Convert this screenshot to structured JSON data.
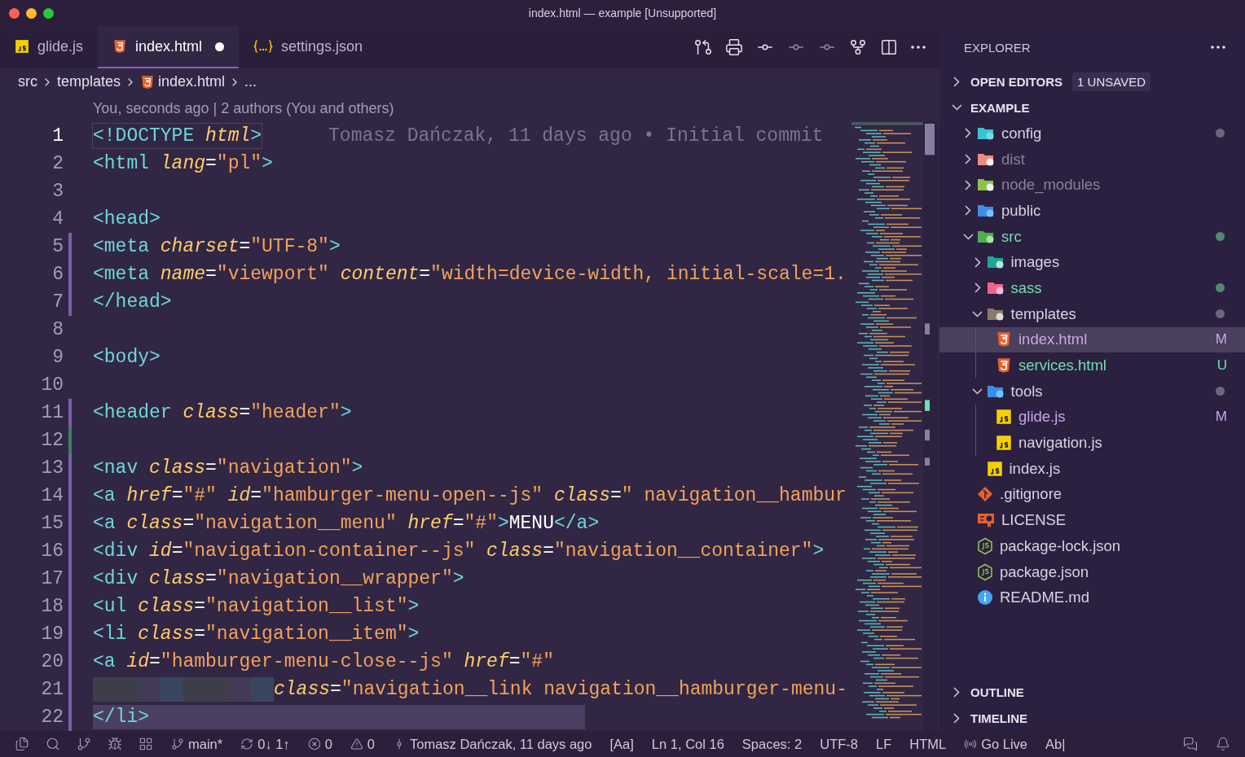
{
  "window": {
    "title": "index.html — example [Unsupported]"
  },
  "tabs": [
    {
      "label": "glide.js",
      "kind": "js",
      "selected": false,
      "dirty": false
    },
    {
      "label": "index.html",
      "kind": "html",
      "selected": true,
      "dirty": true
    },
    {
      "label": "settings.json",
      "kind": "json",
      "selected": false,
      "dirty": false
    }
  ],
  "breadcrumb": [
    {
      "label": "src"
    },
    {
      "label": "templates"
    },
    {
      "label": "index.html",
      "kind": "html"
    },
    {
      "label": "..."
    }
  ],
  "codelens": "You, seconds ago | 2 authors (You and others)",
  "lines": [
    {
      "number": "1",
      "current": true,
      "blame": "Tomasz Dańczak, 11 days ago • Initial commit",
      "tokens": [
        {
          "kind": "tag",
          "text": "<!DOCTYPE"
        },
        {
          "kind": "attr",
          "text": " html"
        },
        {
          "kind": "tag",
          "text": ">"
        }
      ]
    },
    {
      "number": "2",
      "current": false,
      "tokens": [
        {
          "kind": "tag",
          "text": "<html"
        },
        {
          "kind": "attr",
          "text": " lang"
        },
        {
          "kind": "plain",
          "text": "="
        },
        {
          "kind": "str",
          "text": "\"pl\""
        },
        {
          "kind": "tag",
          "text": ">"
        }
      ]
    },
    {
      "number": "3",
      "current": false
    },
    {
      "number": "4",
      "current": false,
      "tokens": [
        {
          "kind": "tag",
          "text": "<head>"
        }
      ]
    },
    {
      "number": "5",
      "current": false,
      "modified": true,
      "tokens": [
        {
          "kind": "tag",
          "text": "<meta"
        },
        {
          "kind": "attr",
          "text": " charset"
        },
        {
          "kind": "plain",
          "text": "="
        },
        {
          "kind": "str",
          "text": "\"UTF-8\""
        },
        {
          "kind": "tag",
          "text": ">"
        }
      ]
    },
    {
      "number": "6",
      "current": false,
      "modified": true,
      "tokens": [
        {
          "kind": "tag",
          "text": "<meta"
        },
        {
          "kind": "attr",
          "text": " name"
        },
        {
          "kind": "plain",
          "text": "="
        },
        {
          "kind": "str",
          "text": "\"viewport\""
        },
        {
          "kind": "attr",
          "text": " content"
        },
        {
          "kind": "plain",
          "text": "="
        },
        {
          "kind": "str",
          "text": "\"width=device-width, initial-scale=1."
        }
      ]
    },
    {
      "number": "7",
      "current": false,
      "modified": true,
      "tokens": [
        {
          "kind": "tag",
          "text": "</head>"
        }
      ]
    },
    {
      "number": "8",
      "current": false
    },
    {
      "number": "9",
      "current": false,
      "tokens": [
        {
          "kind": "tag",
          "text": "<body>"
        }
      ]
    },
    {
      "number": "10",
      "current": false
    },
    {
      "number": "11",
      "current": false,
      "modified": true,
      "tokens": [
        {
          "kind": "tag",
          "text": "<header"
        },
        {
          "kind": "attr",
          "text": " class"
        },
        {
          "kind": "plain",
          "text": "="
        },
        {
          "kind": "str",
          "text": "\"header\""
        },
        {
          "kind": "tag",
          "text": ">"
        }
      ]
    },
    {
      "number": "12",
      "current": false,
      "added": true
    },
    {
      "number": "13",
      "current": false,
      "modified": true,
      "tokens": [
        {
          "kind": "tag",
          "text": "<nav"
        },
        {
          "kind": "attr",
          "text": " class"
        },
        {
          "kind": "plain",
          "text": "="
        },
        {
          "kind": "str",
          "text": "\"navigation\""
        },
        {
          "kind": "tag",
          "text": ">"
        }
      ]
    },
    {
      "number": "14",
      "current": false,
      "modified": true,
      "tokens": [
        {
          "kind": "tag",
          "text": "<a"
        },
        {
          "kind": "attr",
          "text": " href"
        },
        {
          "kind": "plain",
          "text": "="
        },
        {
          "kind": "str",
          "text": "\"#\""
        },
        {
          "kind": "attr",
          "text": " id"
        },
        {
          "kind": "plain",
          "text": "="
        },
        {
          "kind": "str",
          "text": "\"hamburger-menu-open--js\""
        },
        {
          "kind": "attr",
          "text": " class"
        },
        {
          "kind": "plain",
          "text": "="
        },
        {
          "kind": "str",
          "text": "\" navigation__hambur"
        }
      ]
    },
    {
      "number": "15",
      "current": false,
      "modified": true,
      "tokens": [
        {
          "kind": "tag",
          "text": "<a"
        },
        {
          "kind": "attr",
          "text": " class"
        },
        {
          "kind": "plain",
          "text": "="
        },
        {
          "kind": "str",
          "text": "\"navigation__menu\""
        },
        {
          "kind": "attr",
          "text": " href"
        },
        {
          "kind": "plain",
          "text": "="
        },
        {
          "kind": "str",
          "text": "\"#\""
        },
        {
          "kind": "tag",
          "text": ">"
        },
        {
          "kind": "plain",
          "text": "MENU"
        },
        {
          "kind": "tag",
          "text": "</a>"
        }
      ]
    },
    {
      "number": "16",
      "current": false,
      "modified": true,
      "tokens": [
        {
          "kind": "tag",
          "text": "<div"
        },
        {
          "kind": "attr",
          "text": " id"
        },
        {
          "kind": "plain",
          "text": "="
        },
        {
          "kind": "str",
          "text": "\"navigation-container--js\""
        },
        {
          "kind": "attr",
          "text": " class"
        },
        {
          "kind": "plain",
          "text": "="
        },
        {
          "kind": "str",
          "text": "\"navigation__container\""
        },
        {
          "kind": "tag",
          "text": ">"
        }
      ]
    },
    {
      "number": "17",
      "current": false,
      "modified": true,
      "tokens": [
        {
          "kind": "tag",
          "text": "<div"
        },
        {
          "kind": "attr",
          "text": " class"
        },
        {
          "kind": "plain",
          "text": "="
        },
        {
          "kind": "str",
          "text": "\"navigation__wrapper\""
        },
        {
          "kind": "tag",
          "text": ">"
        }
      ]
    },
    {
      "number": "18",
      "current": false,
      "modified": true,
      "tokens": [
        {
          "kind": "tag",
          "text": "<ul"
        },
        {
          "kind": "attr",
          "text": " class"
        },
        {
          "kind": "plain",
          "text": "="
        },
        {
          "kind": "str",
          "text": "\"navigation__list\""
        },
        {
          "kind": "tag",
          "text": ">"
        }
      ]
    },
    {
      "number": "19",
      "current": false,
      "modified": true,
      "tokens": [
        {
          "kind": "tag",
          "text": "<li"
        },
        {
          "kind": "attr",
          "text": " class"
        },
        {
          "kind": "plain",
          "text": "="
        },
        {
          "kind": "str",
          "text": "\"navigation__item\""
        },
        {
          "kind": "tag",
          "text": ">"
        }
      ]
    },
    {
      "number": "20",
      "current": false,
      "modified": true,
      "tokens": [
        {
          "kind": "tag",
          "text": "<a"
        },
        {
          "kind": "attr",
          "text": " id"
        },
        {
          "kind": "plain",
          "text": "="
        },
        {
          "kind": "str",
          "text": "\"hamburger-menu-close--js\""
        },
        {
          "kind": "attr",
          "text": " href"
        },
        {
          "kind": "plain",
          "text": "="
        },
        {
          "kind": "str",
          "text": "\"#\""
        }
      ]
    },
    {
      "number": "21",
      "current": false,
      "modified": true,
      "kind": "continuation",
      "tokens": [
        {
          "kind": "attr",
          "text": "class"
        },
        {
          "kind": "plain",
          "text": "="
        },
        {
          "kind": "str",
          "text": "\"navigation__link navigation__hamburger-menu-"
        }
      ]
    },
    {
      "number": "22",
      "current": false,
      "modified": true,
      "highlighted": true,
      "tokens": [
        {
          "kind": "tag",
          "text": "</li>"
        }
      ]
    }
  ],
  "explorer": {
    "title": "EXPLORER",
    "sections": [
      {
        "label": "OPEN EDITORS",
        "expanded": false,
        "badge": "1 UNSAVED"
      },
      {
        "label": "EXAMPLE",
        "expanded": true
      }
    ],
    "tree": [
      {
        "label": "config",
        "kind": "config-folder",
        "expanded": false,
        "selected": false,
        "color": "#6e6680"
      },
      {
        "label": "dist",
        "kind": "dist-folder",
        "ignored": true,
        "expanded": false,
        "selected": false
      },
      {
        "label": "node_modules",
        "kind": "node-folder",
        "ignored": true,
        "expanded": false,
        "selected": false
      },
      {
        "label": "public",
        "kind": "public-folder",
        "expanded": false,
        "selected": false
      },
      {
        "label": "src",
        "kind": "src-folder",
        "added": true,
        "expanded": true,
        "selected": false,
        "color": "#4e8a72",
        "children": [
          {
            "label": "images",
            "kind": "images-folder",
            "expanded": false,
            "selected": false
          },
          {
            "label": "sass",
            "kind": "sass-folder",
            "added": true,
            "expanded": false,
            "selected": false,
            "color": "#4e8a72"
          },
          {
            "label": "templates",
            "kind": "templates-folder",
            "expanded": true,
            "selected": false,
            "color": "#6e6680",
            "children": [
              {
                "label": "index.html",
                "kind": "html",
                "modified": true,
                "selected": true,
                "badge": "M"
              },
              {
                "label": "services.html",
                "kind": "html",
                "added": true,
                "selected": false,
                "badge": "U"
              }
            ]
          },
          {
            "label": "tools",
            "kind": "tools-folder",
            "expanded": true,
            "selected": false,
            "color": "#6e6680",
            "children": [
              {
                "label": "glide.js",
                "kind": "js",
                "modified": true,
                "selected": false,
                "badge": "M"
              },
              {
                "label": "navigation.js",
                "kind": "js",
                "selected": false
              }
            ]
          },
          {
            "label": "index.js",
            "kind": "js",
            "selected": false
          }
        ]
      },
      {
        "label": ".gitignore",
        "kind": "git",
        "selected": false
      },
      {
        "label": "LICENSE",
        "kind": "license",
        "selected": false
      },
      {
        "label": "package-lock.json",
        "kind": "node",
        "selected": false
      },
      {
        "label": "package.json",
        "kind": "node",
        "selected": false
      },
      {
        "label": "README.md",
        "kind": "info",
        "selected": false
      }
    ],
    "bottom_sections": [
      {
        "label": "OUTLINE",
        "expanded": false
      },
      {
        "label": "TIMELINE",
        "expanded": false
      }
    ]
  },
  "status_bar": [
    {
      "kind": "branch",
      "text": "main*"
    },
    {
      "kind": "sync",
      "text": "0↓ 1↑"
    },
    {
      "kind": "error",
      "text": "0"
    },
    {
      "kind": "warning",
      "text": "0"
    },
    {
      "kind": "commit",
      "text": "Tomasz Dańczak, 11 days ago"
    },
    {
      "text": "[Aa]"
    },
    {
      "text": "Ln 1, Col 16"
    },
    {
      "text": "Spaces: 2"
    },
    {
      "text": "UTF-8"
    },
    {
      "text": "LF"
    },
    {
      "text": "HTML"
    },
    {
      "kind": "live",
      "text": "Go Live"
    },
    {
      "text": "Ab|"
    }
  ]
}
